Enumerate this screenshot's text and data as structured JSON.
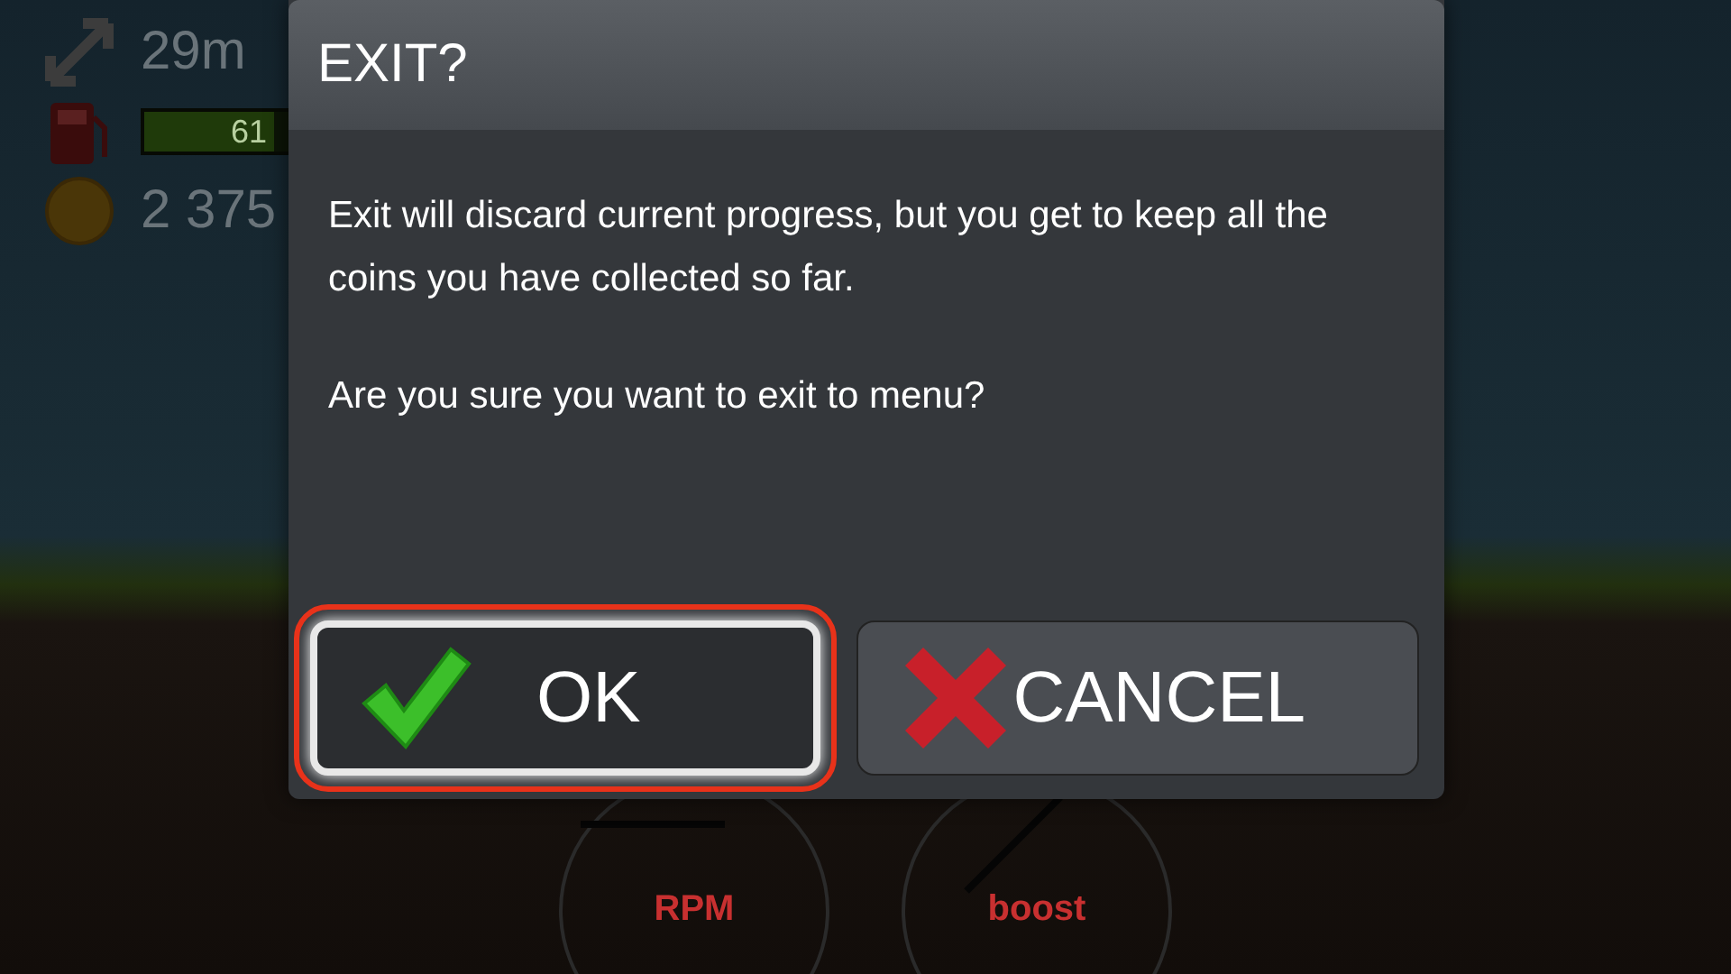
{
  "hud": {
    "distance": "29m",
    "fuel": {
      "level": 0.75,
      "reading": "61"
    },
    "coins": "2 375"
  },
  "gauges": [
    {
      "label": "RPM",
      "kind": "rpm"
    },
    {
      "label": "boost",
      "kind": "boost"
    }
  ],
  "dialog": {
    "title": "EXIT?",
    "paragraphs": [
      "Exit will discard current progress, but you get to keep all the coins you have collected so far.",
      "Are you sure you want to exit to menu?"
    ],
    "buttons": [
      {
        "label": "OK",
        "kind": "confirm",
        "highlighted": true
      },
      {
        "label": "CANCEL",
        "kind": "cancel",
        "highlighted": false
      }
    ]
  }
}
